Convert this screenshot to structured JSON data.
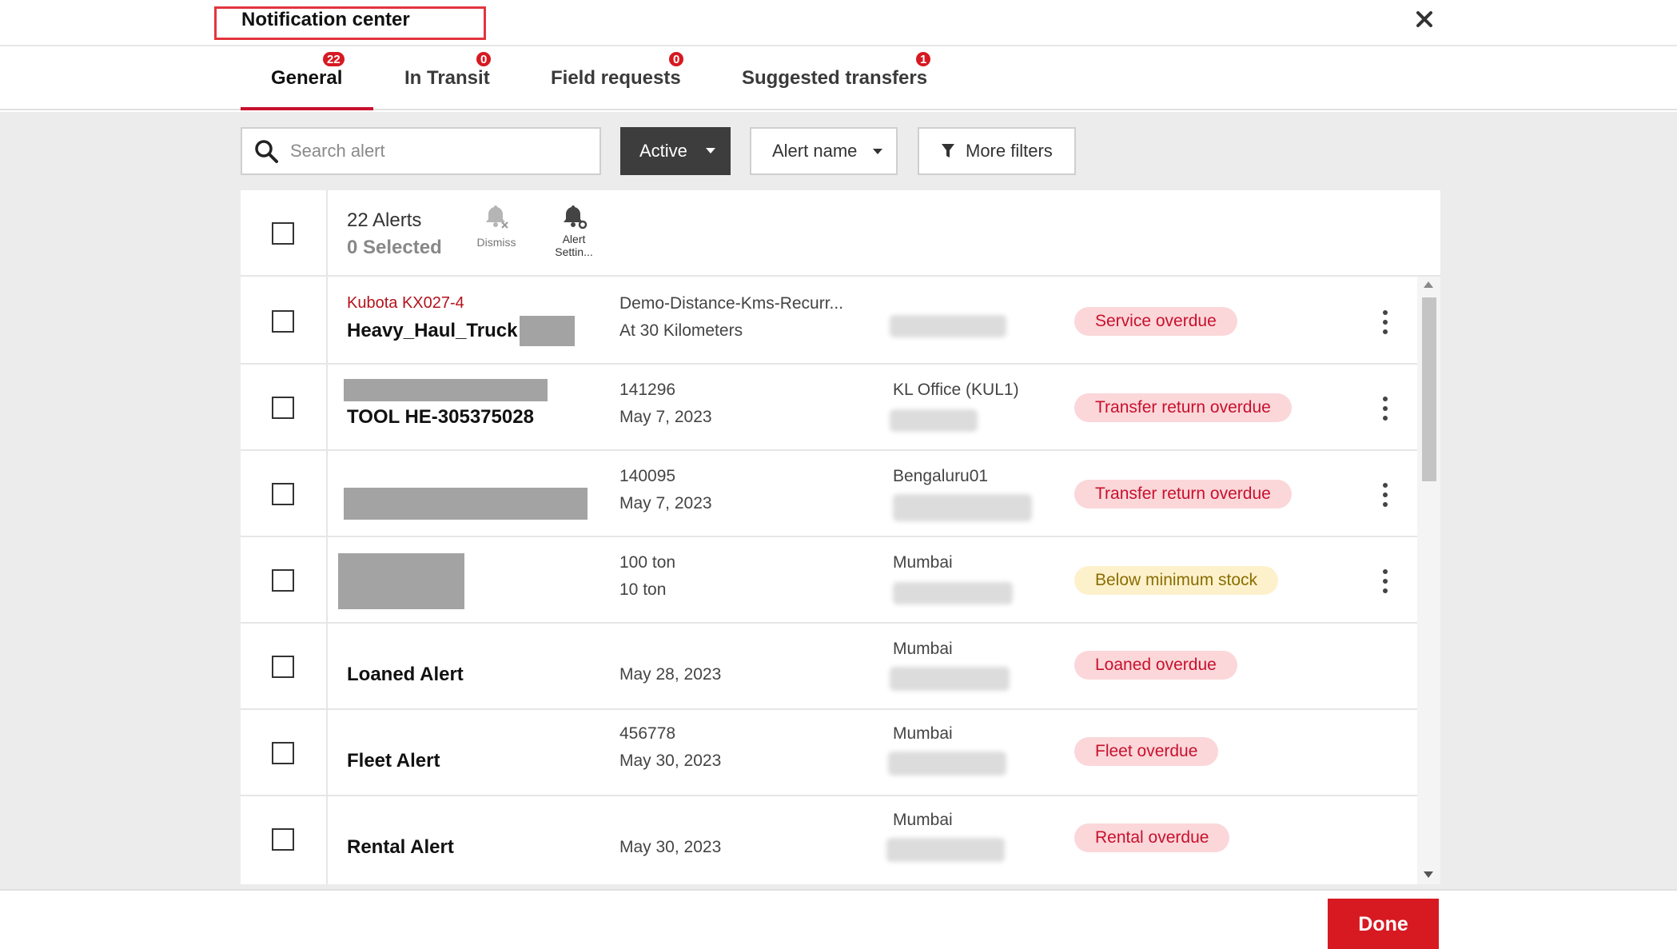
{
  "header": {
    "title": "Notification center"
  },
  "tabs": [
    {
      "label": "General",
      "badge": "22",
      "active": true
    },
    {
      "label": "In Transit",
      "badge": "0",
      "active": false
    },
    {
      "label": "Field requests",
      "badge": "0",
      "active": false
    },
    {
      "label": "Suggested transfers",
      "badge": "1",
      "active": false
    }
  ],
  "filters": {
    "search_placeholder": "Search alert",
    "status_value": "Active",
    "sort_value": "Alert name",
    "more_filters_label": "More filters"
  },
  "list_header": {
    "alerts_count": "22 Alerts",
    "selected_count": "0 Selected",
    "dismiss_label": "Dismiss",
    "settings_label_line1": "Alert",
    "settings_label_line2": "Settin..."
  },
  "rows": [
    {
      "model": "Kubota KX027-4",
      "name": "Heavy_Haul_Truck",
      "detail1": "Demo-Distance-Kms-Recurr...",
      "detail2": "At 30 Kilometers",
      "location": "",
      "status": "Service overdue",
      "status_color": "red",
      "has_menu": true
    },
    {
      "model": "",
      "name": "TOOL HE-305375028",
      "detail1": "141296",
      "detail2": "May 7, 2023",
      "location": "KL Office (KUL1)",
      "status": "Transfer return overdue",
      "status_color": "red",
      "has_menu": true
    },
    {
      "model": "",
      "name": "",
      "detail1": "140095",
      "detail2": "May 7, 2023",
      "location": "Bengaluru01",
      "status": "Transfer return overdue",
      "status_color": "red",
      "has_menu": true
    },
    {
      "model": "",
      "name": "",
      "detail1": "100 ton",
      "detail2": "10 ton",
      "location": "Mumbai",
      "status": "Below minimum stock",
      "status_color": "yellow",
      "has_menu": true
    },
    {
      "model": "",
      "name": "Loaned Alert",
      "detail1": "",
      "detail2": "May 28, 2023",
      "location": "Mumbai",
      "status": "Loaned overdue",
      "status_color": "red",
      "has_menu": false
    },
    {
      "model": "",
      "name": "Fleet Alert",
      "detail1": "456778",
      "detail2": "May 30, 2023",
      "location": "Mumbai",
      "status": "Fleet overdue",
      "status_color": "red",
      "has_menu": false
    },
    {
      "model": "",
      "name": "Rental Alert",
      "detail1": "",
      "detail2": "May 30, 2023",
      "location": "Mumbai",
      "status": "Rental overdue",
      "status_color": "red",
      "has_menu": false
    }
  ],
  "footer": {
    "done_label": "Done"
  },
  "colors": {
    "brand_red": "#d71921",
    "pill_red_bg": "#fbd7d9",
    "pill_yellow_bg": "#fdf1cc",
    "dark_button": "#3d3d3d"
  }
}
